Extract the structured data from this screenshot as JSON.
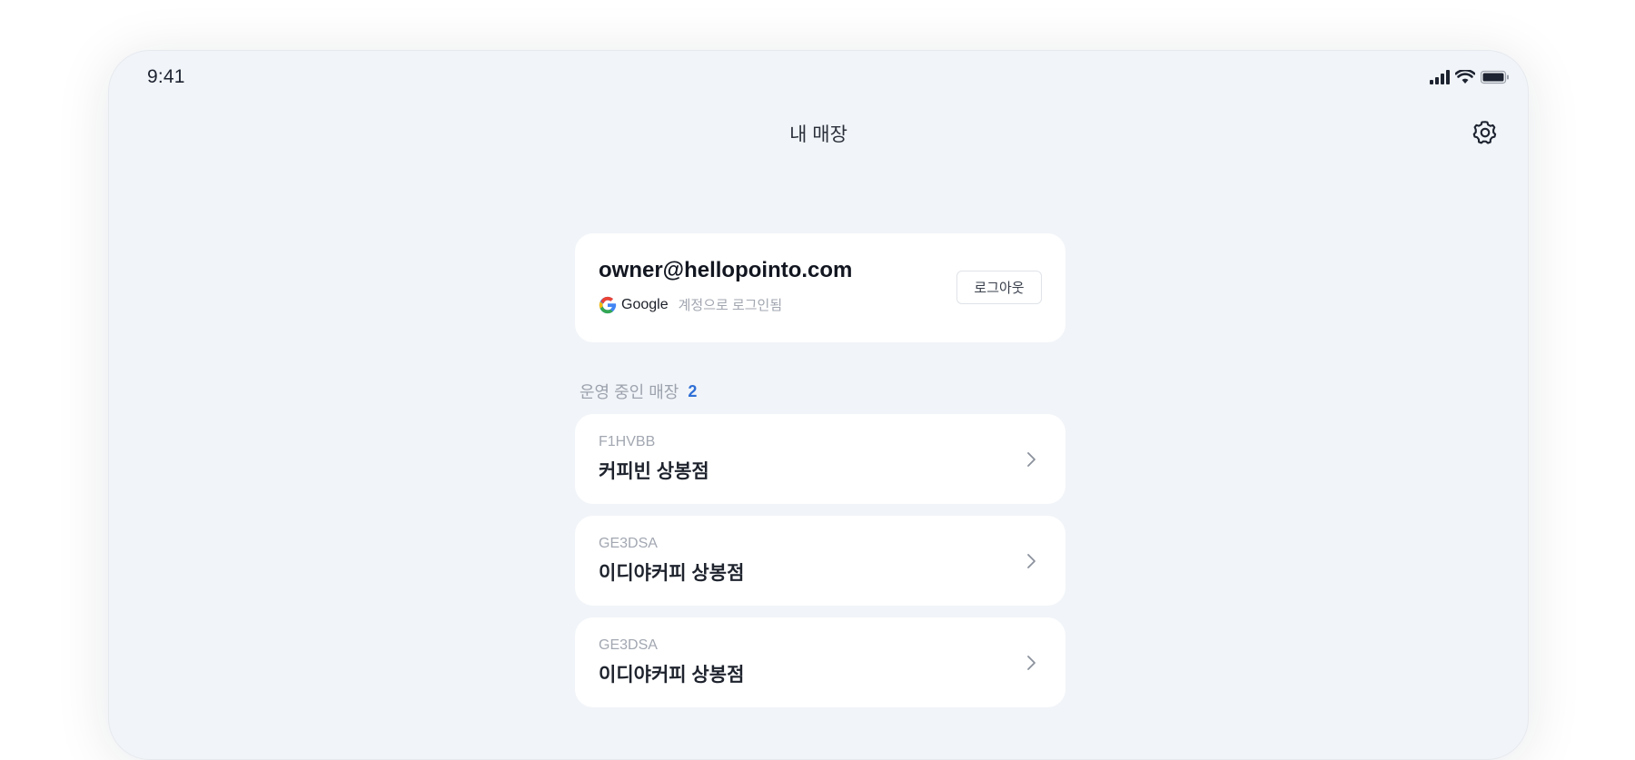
{
  "status_bar": {
    "time": "9:41",
    "icons": [
      "signal-icon",
      "wifi-icon",
      "battery-icon"
    ]
  },
  "header": {
    "title": "내 매장",
    "settings_icon": "gear-icon"
  },
  "account": {
    "email": "owner@hellopointo.com",
    "provider_icon": "google-icon",
    "provider": "Google",
    "provider_suffix": "계정으로 로그인됨",
    "logout_label": "로그아웃"
  },
  "stores_section": {
    "label": "운영 중인 매장",
    "count": "2",
    "count_color": "#2f6fd6"
  },
  "stores": [
    {
      "code": "F1HVBB",
      "name": "커피빈 상봉점"
    },
    {
      "code": "GE3DSA",
      "name": "이디야커피 상봉점"
    },
    {
      "code": "GE3DSA",
      "name": "이디야커피 상봉점"
    }
  ],
  "colors": {
    "background": "#f1f4f8",
    "card": "#ffffff",
    "accent": "#2f6fd6"
  }
}
